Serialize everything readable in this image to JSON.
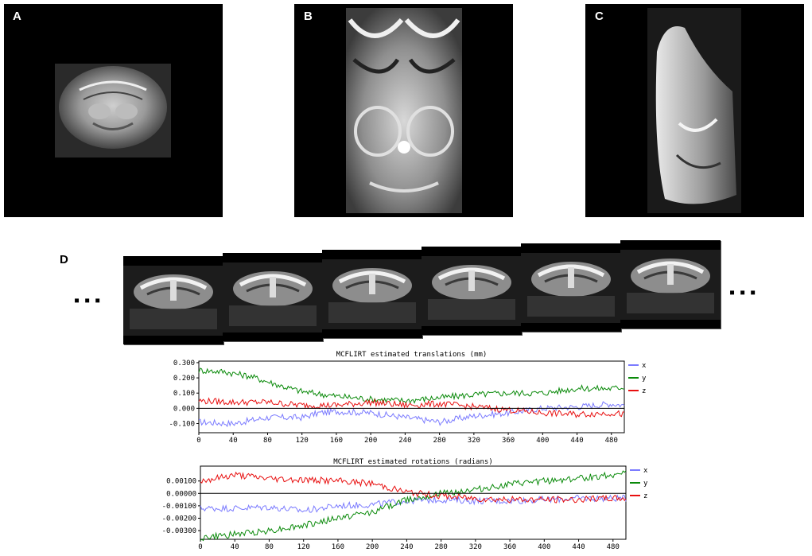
{
  "panels": {
    "a": {
      "label": "A"
    },
    "b": {
      "label": "B"
    },
    "c": {
      "label": "C"
    },
    "d": {
      "label": "D"
    }
  },
  "timeseries": {
    "frame_count": 6,
    "continuation_left": "▪▪▪",
    "continuation_right": "▪▪▪"
  },
  "chart_data": [
    {
      "type": "line",
      "title": "MCFLIRT estimated translations (mm)",
      "xlabel": "",
      "ylabel": "",
      "xlim": [
        0,
        495
      ],
      "ylim": [
        -0.16,
        0.31
      ],
      "x_ticks": [
        "0",
        "40",
        "80",
        "120",
        "160",
        "200",
        "240",
        "280",
        "320",
        "360",
        "400",
        "440",
        "480"
      ],
      "y_ticks": [
        "0.300",
        "0.200",
        "0.100",
        "0.000",
        "-0.100"
      ],
      "y_tick_values": [
        0.3,
        0.2,
        0.1,
        0.0,
        -0.1
      ],
      "zero_line": 0.0,
      "legend_position": "right",
      "series": [
        {
          "name": "x",
          "color": "#7b7bff",
          "keypoints": [
            [
              0,
              -0.09
            ],
            [
              40,
              -0.1
            ],
            [
              80,
              -0.06
            ],
            [
              120,
              -0.06
            ],
            [
              140,
              -0.03
            ],
            [
              160,
              -0.02
            ],
            [
              200,
              -0.03
            ],
            [
              240,
              -0.06
            ],
            [
              280,
              -0.09
            ],
            [
              320,
              -0.05
            ],
            [
              360,
              -0.03
            ],
            [
              400,
              0.0
            ],
            [
              440,
              0.01
            ],
            [
              480,
              0.03
            ],
            [
              495,
              0.02
            ]
          ]
        },
        {
          "name": "y",
          "color": "#0a8a0a",
          "keypoints": [
            [
              0,
              0.25
            ],
            [
              30,
              0.24
            ],
            [
              60,
              0.21
            ],
            [
              100,
              0.14
            ],
            [
              120,
              0.11
            ],
            [
              160,
              0.08
            ],
            [
              200,
              0.06
            ],
            [
              240,
              0.05
            ],
            [
              280,
              0.07
            ],
            [
              320,
              0.09
            ],
            [
              360,
              0.1
            ],
            [
              400,
              0.1
            ],
            [
              440,
              0.13
            ],
            [
              480,
              0.13
            ],
            [
              495,
              0.14
            ]
          ]
        },
        {
          "name": "z",
          "color": "#e81010",
          "keypoints": [
            [
              0,
              0.05
            ],
            [
              40,
              0.04
            ],
            [
              80,
              0.04
            ],
            [
              120,
              0.02
            ],
            [
              160,
              0.02
            ],
            [
              200,
              0.04
            ],
            [
              240,
              0.02
            ],
            [
              280,
              0.03
            ],
            [
              320,
              0.01
            ],
            [
              360,
              -0.01
            ],
            [
              400,
              -0.03
            ],
            [
              440,
              -0.04
            ],
            [
              480,
              -0.03
            ],
            [
              495,
              -0.04
            ]
          ]
        }
      ]
    },
    {
      "type": "line",
      "title": "MCFLIRT estimated rotations (radians)",
      "xlabel": "",
      "ylabel": "",
      "xlim": [
        0,
        495
      ],
      "ylim": [
        -0.0037,
        0.0022
      ],
      "x_ticks": [
        "0",
        "40",
        "80",
        "120",
        "160",
        "200",
        "240",
        "280",
        "320",
        "360",
        "400",
        "440",
        "480"
      ],
      "y_ticks": [
        "0.00100",
        "0.00000",
        "-0.00100",
        "-0.00200",
        "-0.00300"
      ],
      "y_tick_values": [
        0.001,
        0.0,
        -0.001,
        -0.002,
        -0.003
      ],
      "zero_line": 0.0,
      "legend_position": "right",
      "series": [
        {
          "name": "x",
          "color": "#7b7bff",
          "keypoints": [
            [
              0,
              -0.0012
            ],
            [
              40,
              -0.0012
            ],
            [
              80,
              -0.0011
            ],
            [
              120,
              -0.0014
            ],
            [
              160,
              -0.001
            ],
            [
              200,
              -0.0009
            ],
            [
              240,
              -0.0006
            ],
            [
              280,
              -0.0005
            ],
            [
              320,
              -0.0006
            ],
            [
              360,
              -0.0006
            ],
            [
              400,
              -0.0005
            ],
            [
              440,
              -0.0004
            ],
            [
              480,
              -0.0004
            ],
            [
              495,
              -0.0004
            ]
          ]
        },
        {
          "name": "y",
          "color": "#0a8a0a",
          "keypoints": [
            [
              0,
              -0.0036
            ],
            [
              40,
              -0.0033
            ],
            [
              80,
              -0.003
            ],
            [
              120,
              -0.0026
            ],
            [
              160,
              -0.002
            ],
            [
              200,
              -0.0015
            ],
            [
              240,
              -0.0005
            ],
            [
              280,
              0.0
            ],
            [
              320,
              0.0003
            ],
            [
              360,
              0.0007
            ],
            [
              400,
              0.001
            ],
            [
              440,
              0.0012
            ],
            [
              480,
              0.0015
            ],
            [
              495,
              0.0017
            ]
          ]
        },
        {
          "name": "z",
          "color": "#e81010",
          "keypoints": [
            [
              0,
              0.001
            ],
            [
              40,
              0.0015
            ],
            [
              80,
              0.0012
            ],
            [
              120,
              0.0011
            ],
            [
              160,
              0.001
            ],
            [
              200,
              0.0008
            ],
            [
              240,
              0.0001
            ],
            [
              280,
              -0.0002
            ],
            [
              320,
              -0.0004
            ],
            [
              360,
              -0.0005
            ],
            [
              400,
              -0.0005
            ],
            [
              440,
              -0.0005
            ],
            [
              480,
              -0.0004
            ],
            [
              495,
              -0.0004
            ]
          ]
        }
      ]
    }
  ]
}
